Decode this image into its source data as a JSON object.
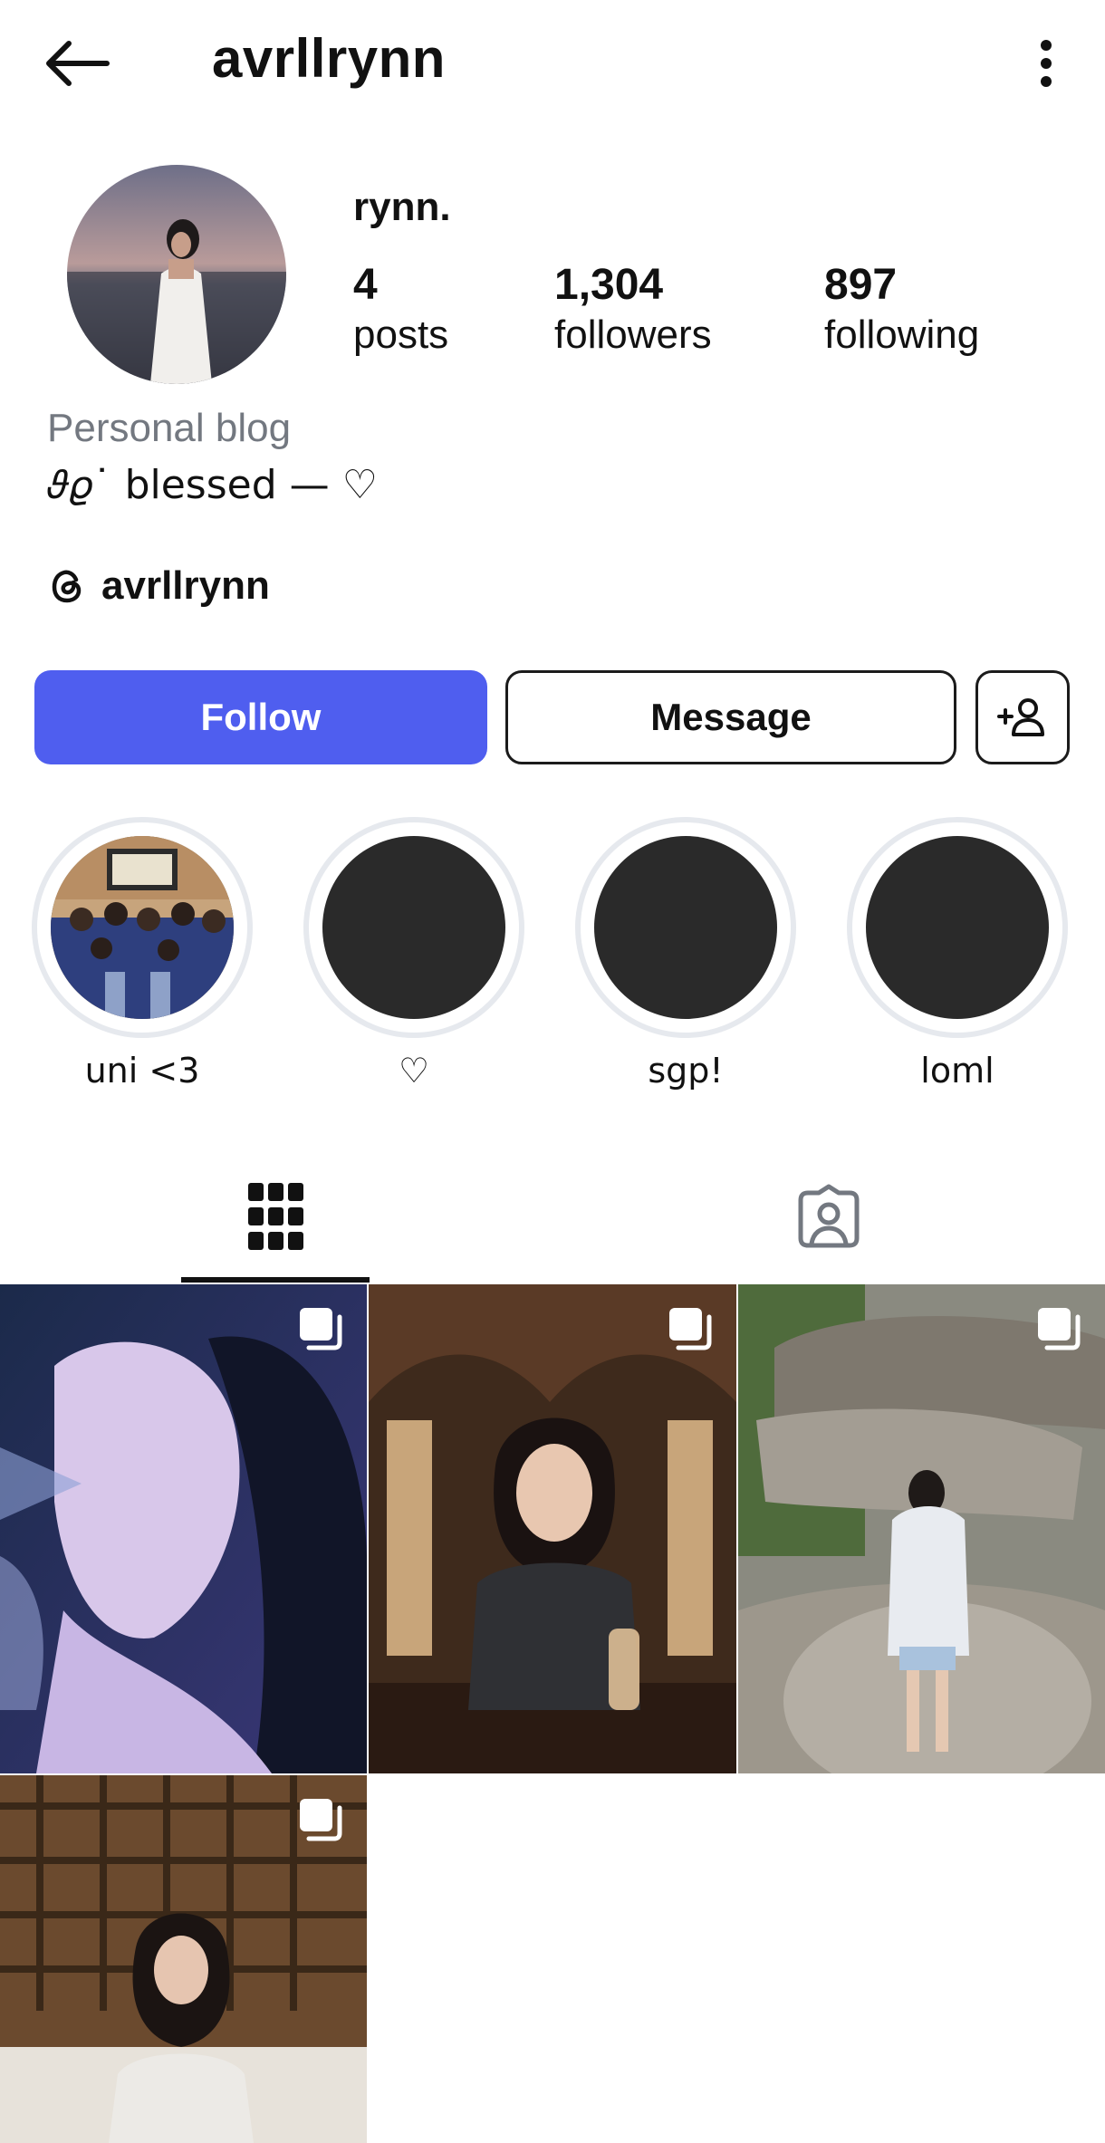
{
  "header": {
    "username": "avrllrynn"
  },
  "profile": {
    "display_name": "rynn.",
    "stats": {
      "posts": {
        "value": "4",
        "label": "posts"
      },
      "followers": {
        "value": "1,304",
        "label": "followers"
      },
      "following": {
        "value": "897",
        "label": "following"
      }
    },
    "category": "Personal blog",
    "bio": "𝜗𝜚˙ blessed — ♡",
    "threads_handle": "avrllrynn"
  },
  "actions": {
    "follow": "Follow",
    "message": "Message"
  },
  "highlights": [
    {
      "label": "uni <3"
    },
    {
      "label": "♡"
    },
    {
      "label": "sgp!"
    },
    {
      "label": "loml"
    }
  ],
  "colors": {
    "accent": "#4f5eef",
    "text": "#111111",
    "muted": "#737880"
  },
  "icons": [
    "back-arrow-icon",
    "more-vertical-icon",
    "threads-icon",
    "add-person-icon",
    "grid-icon",
    "tagged-icon",
    "multi-photo-icon"
  ]
}
